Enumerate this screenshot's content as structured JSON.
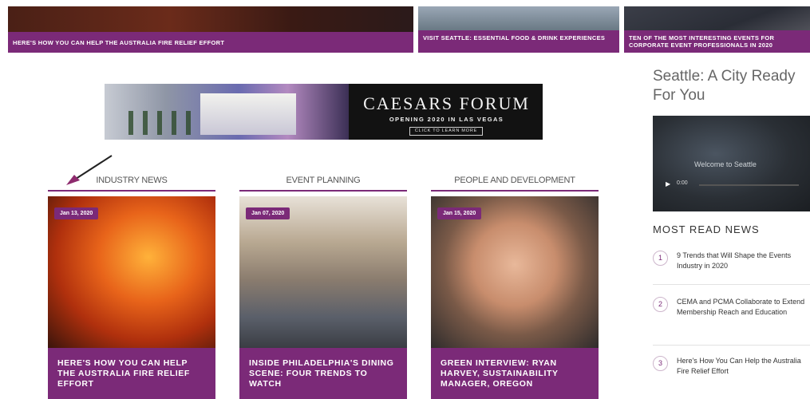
{
  "hero": [
    {
      "caption": "HERE'S HOW YOU CAN HELP THE AUSTRALIA FIRE RELIEF EFFORT"
    },
    {
      "caption": "VISIT SEATTLE: ESSENTIAL FOOD & DRINK EXPERIENCES"
    },
    {
      "caption": "TEN OF THE MOST INTERESTING EVENTS FOR CORPORATE EVENT PROFESSIONALS IN 2020"
    }
  ],
  "ad": {
    "title": "CAESARS FORUM",
    "subtitle": "OPENING 2020 IN LAS VEGAS",
    "cta": "CLICK TO LEARN MORE"
  },
  "cards": [
    {
      "category": "INDUSTRY NEWS",
      "date": "Jan 13, 2020",
      "headline": "HERE'S HOW YOU CAN HELP THE AUSTRALIA FIRE RELIEF EFFORT"
    },
    {
      "category": "EVENT PLANNING",
      "date": "Jan 07, 2020",
      "headline": "INSIDE PHILADELPHIA'S DINING SCENE: FOUR TRENDS TO WATCH"
    },
    {
      "category": "PEOPLE AND DEVELOPMENT",
      "date": "Jan 15, 2020",
      "headline": "GREEN INTERVIEW: RYAN HARVEY, SUSTAINABILITY MANAGER, OREGON"
    }
  ],
  "sidebar": {
    "title": "Seattle: A City Ready For You",
    "video": {
      "label": "Welcome to Seattle",
      "time": "0:00"
    },
    "most_read_title": "MOST READ NEWS",
    "most_read": [
      {
        "num": "1",
        "text": "9 Trends that Will Shape the Events Industry in 2020"
      },
      {
        "num": "2",
        "text": "CEMA and PCMA Collaborate to Extend Membership Reach and Education"
      },
      {
        "num": "3",
        "text": "Here's How You Can Help the Australia Fire Relief Effort"
      }
    ]
  },
  "colors": {
    "accent": "#7b2a78",
    "annotation_arrow": "#222222"
  },
  "icons": [
    "play-icon",
    "annotation-arrow-icon"
  ]
}
